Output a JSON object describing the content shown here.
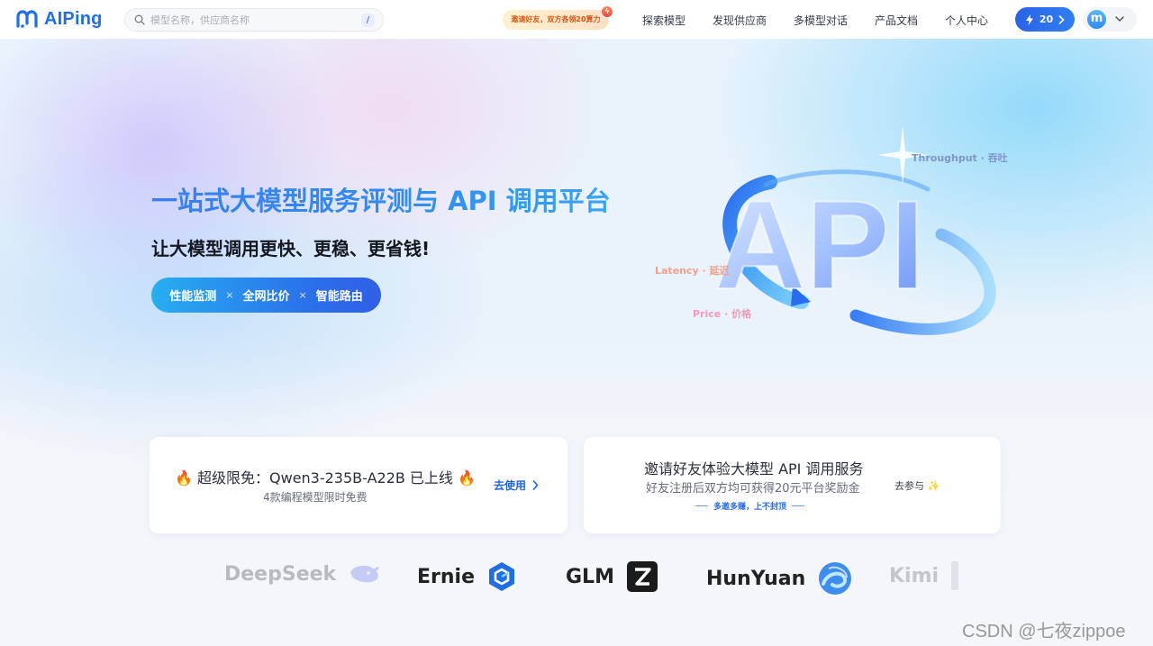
{
  "header": {
    "logo_text": "AIPing",
    "search": {
      "placeholder": "模型名称，供应商名称",
      "shortcut": "/"
    },
    "invite_promo": "邀请好友，双方各领20算力",
    "nav": [
      {
        "label": "探索模型"
      },
      {
        "label": "发现供应商"
      },
      {
        "label": "多模型对话"
      },
      {
        "label": "产品文档"
      },
      {
        "label": "个人中心"
      }
    ],
    "credits": "20",
    "avatar_letter": "m"
  },
  "hero": {
    "title": "一站式大模型服务评测与 API 调用平台",
    "subtitle": "让大模型调用更快、更稳、更省钱!",
    "features": [
      "性能监测",
      "全网比价",
      "智能路由"
    ],
    "feature_sep": "×",
    "art_text": "API",
    "metrics": {
      "throughput": "Throughput · 吞吐",
      "latency": "Latency · 延迟",
      "price": "Price · 价格"
    }
  },
  "cards": {
    "promo": {
      "title": "🔥 超级限免：Qwen3-235B-A22B 已上线 🔥",
      "subtitle": "4款编程模型限时免费",
      "action": "去使用"
    },
    "invite": {
      "title": "邀请好友体验大模型 API 调用服务",
      "subtitle": "好友注册后双方均可获得20元平台奖励金",
      "tag": "多邀多赚，上不封顶",
      "action": "去参与",
      "action_icon": "✨"
    }
  },
  "brands": [
    {
      "name": "DeepSeek",
      "icon": "whale-icon"
    },
    {
      "name": "Ernie",
      "icon": "ernie-hex-icon"
    },
    {
      "name": "GLM",
      "icon": "z-square-icon"
    },
    {
      "name": "HunYuan",
      "icon": "hunyuan-swirl-icon"
    },
    {
      "name": "Kimi",
      "icon": "kimi-icon"
    }
  ],
  "watermark": "CSDN @七夜zippoe",
  "colors": {
    "brand_blue": "#1f6fe8",
    "accent_orange": "#d5571a",
    "link_blue": "#1f63e6"
  }
}
